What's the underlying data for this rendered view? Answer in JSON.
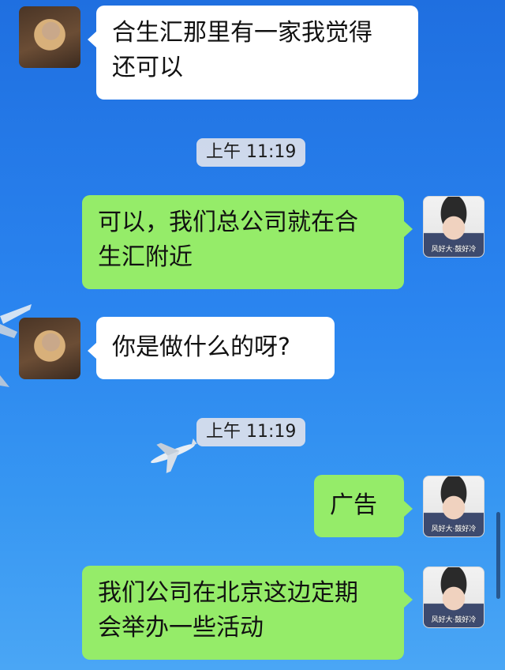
{
  "messages": [
    {
      "side": "left",
      "text_line1": "合生汇那里有一家我觉得",
      "text_line2": "还可以"
    },
    {
      "side": "right",
      "text_line1": "可以，我们总公司就在合",
      "text_line2": "生汇附近"
    },
    {
      "side": "left",
      "text_line1": "你是做什么的呀?"
    },
    {
      "side": "right",
      "text_line1": "广告"
    },
    {
      "side": "right",
      "text_line1": "我们公司在北京这边定期",
      "text_line2": "会举办一些活动"
    }
  ],
  "timestamps": [
    "上午 11:19",
    "上午 11:19"
  ],
  "avatar_tag": "风好大·鼓好冷",
  "colors": {
    "sent_bubble": "#95ec69",
    "received_bubble": "#ffffff",
    "background": "#2a84ef"
  }
}
